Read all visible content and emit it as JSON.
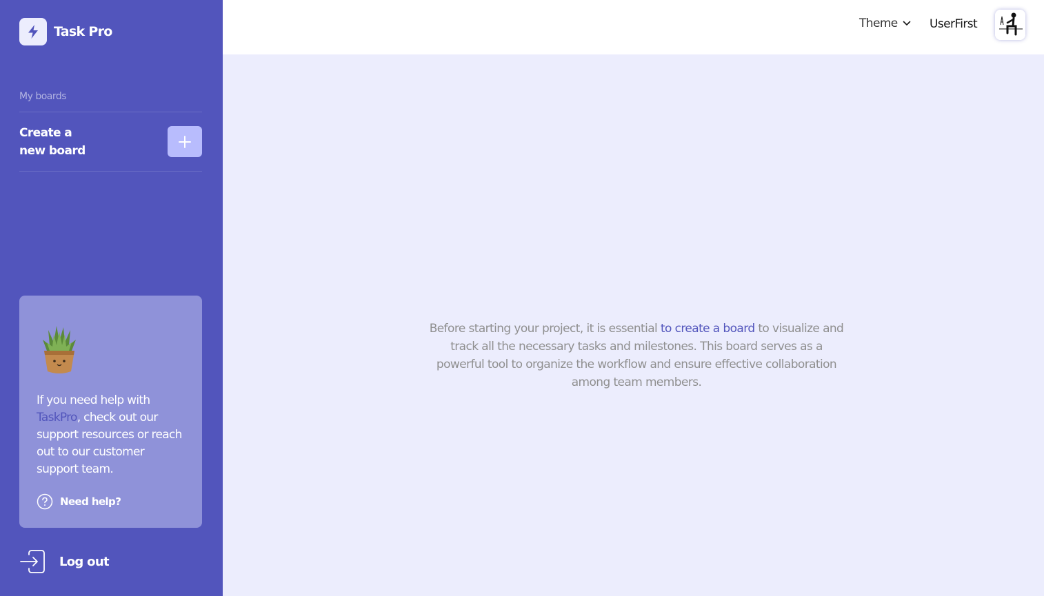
{
  "app": {
    "title": "Task Pro"
  },
  "sidebar": {
    "boards_title": "My boards",
    "create_board_label": "Create a new board",
    "help": {
      "text_before": "If you need help with ",
      "link": "TaskPro",
      "text_after": ", check out our support resources or reach out to our customer support team.",
      "button_label": "Need help?"
    },
    "logout_label": "Log out"
  },
  "header": {
    "theme_label": "Theme",
    "username": "UserFirst"
  },
  "main": {
    "intro_before": "Before starting your project, it is essential ",
    "intro_link": "to create a board",
    "intro_after": " to visualize and track all the necessary tasks and milestones. This board serves as a powerful tool to organize the workflow and ensure effective collaboration among team members."
  },
  "colors": {
    "sidebar_bg": "#5255bc",
    "main_bg": "#ecedfd",
    "create_button": "#b8bcfd",
    "help_card": "#8f92d9",
    "accent": "#5255bc"
  },
  "icons": {
    "logo": "lightning-icon",
    "create": "plus-icon",
    "help": "question-circle-icon",
    "logout": "logout-icon",
    "theme": "chevron-down-icon",
    "plant": "cactus-plant-icon"
  }
}
